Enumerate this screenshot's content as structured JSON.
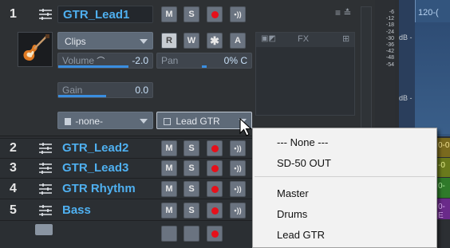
{
  "track1": {
    "number": "1",
    "name": "GTR_Lead1",
    "buttons": {
      "mute": "M",
      "solo": "S",
      "read": "R",
      "write": "W",
      "star": "✱",
      "auto": "A"
    },
    "clips_dropdown": "Clips",
    "volume_label": "Volume",
    "volume_value": "-2.0",
    "pan_label": "Pan",
    "pan_value": "0% C",
    "gain_label": "Gain",
    "gain_value": "0.0",
    "input_value": "-none-",
    "output_value": "Lead GTR",
    "fx_label": "FX",
    "clip_label": "120-(",
    "db_label_1": "dB -",
    "db_label_2": "dB -",
    "meter_scale": [
      "-6",
      "-12",
      "-18",
      "-24",
      "-30",
      "-36",
      "-42",
      "-48",
      "-54"
    ],
    "peak_value": "-"
  },
  "tracks": [
    {
      "number": "2",
      "name": "GTR_Lead2",
      "clip": "0-0"
    },
    {
      "number": "3",
      "name": "GTR_Lead3",
      "clip": "-0"
    },
    {
      "number": "4",
      "name": "GTR Rhythm",
      "clip": "0-"
    },
    {
      "number": "5",
      "name": "Bass",
      "clip": "0-E"
    }
  ],
  "output_menu": {
    "items": [
      "--- None ---",
      "SD-50 OUT",
      "Master",
      "Drums",
      "Lead GTR"
    ]
  },
  "colors": {
    "track_name": "#4fb0f0",
    "record": "#e6101a",
    "accent_bar": "#3a8ee0"
  }
}
